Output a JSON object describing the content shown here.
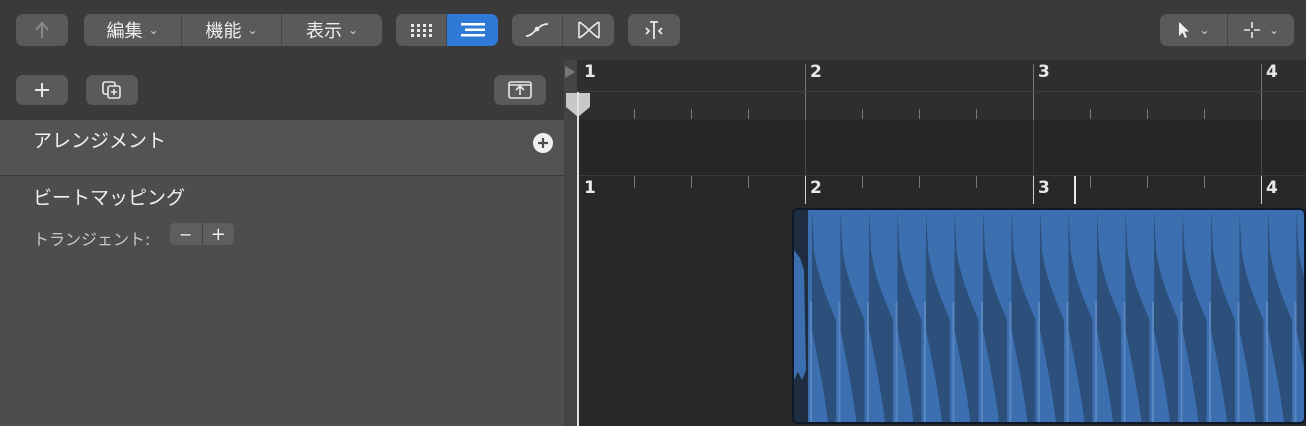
{
  "toolbar": {
    "back_icon": "back-arrow-icon",
    "menus": [
      {
        "label": "編集"
      },
      {
        "label": "機能"
      },
      {
        "label": "表示"
      }
    ],
    "view_icons": [
      "grid-view-icon",
      "list-view-icon"
    ],
    "active_view": "list-view-icon",
    "accent_color": "#2f7ad6",
    "curve_tools": [
      "curve-icon",
      "crossfade-icon"
    ],
    "snap_icon": "snap-icon",
    "pointer_tool": "pointer-tool-icon",
    "secondary_tool": "crosshair-tool-icon"
  },
  "panel": {
    "add_icon": "plus-icon",
    "duplicate_icon": "duplicate-icon",
    "collapse_icon": "upload-box-icon",
    "arrangement_label": "アレンジメント",
    "beat_mapping_label": "ビートマッピング",
    "transient_label": "トランジェント:",
    "transient_minus": "−",
    "transient_plus": "+"
  },
  "ruler": {
    "bars": [
      "1",
      "2",
      "3",
      "4"
    ]
  },
  "beat_ruler": {
    "bars": [
      "1",
      "2",
      "3",
      "4"
    ]
  },
  "region": {
    "color": "#3b6fb0"
  }
}
